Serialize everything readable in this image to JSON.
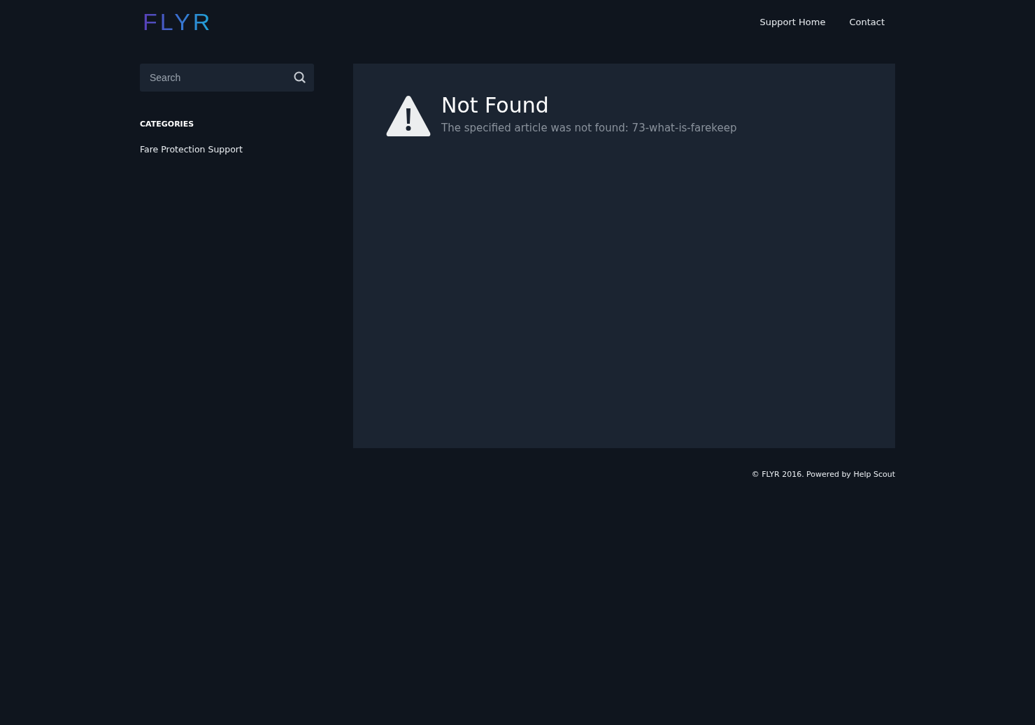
{
  "header": {
    "logo": "FLYR",
    "nav": [
      {
        "label": "Support Home"
      },
      {
        "label": "Contact"
      }
    ]
  },
  "sidebar": {
    "search": {
      "placeholder": "Search"
    },
    "categories_heading": "CATEGORIES",
    "categories": [
      {
        "label": "Fare Protection Support"
      }
    ]
  },
  "main": {
    "title": "Not Found",
    "message": "The specified article was not found: 73-what-is-farekeep"
  },
  "footer": {
    "text": "© FLYR 2016. Powered by",
    "link": "Help Scout"
  }
}
